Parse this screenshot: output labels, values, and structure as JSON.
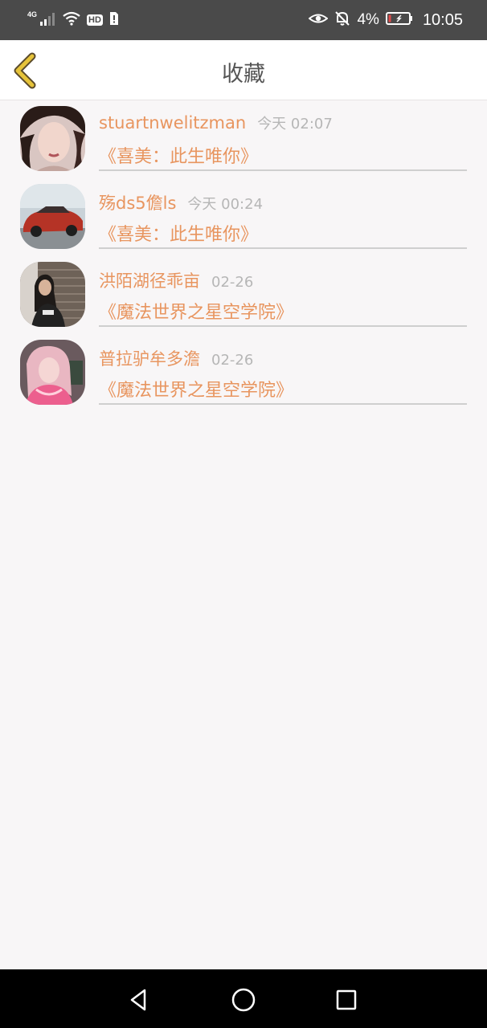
{
  "status_bar": {
    "network": "4G",
    "battery_percent": "4%",
    "time": "10:05",
    "hd_label": "HD",
    "icons": [
      "signal-icon",
      "wifi-icon",
      "hd-icon",
      "sim-icon",
      "eye-icon",
      "mute-bell-icon",
      "battery-icon"
    ]
  },
  "header": {
    "title": "收藏",
    "back_icon": "chevron-left-icon"
  },
  "favorites": [
    {
      "name": "stuartnwelitzman",
      "time": "今天 02:07",
      "book": "《喜美：此生唯你》"
    },
    {
      "name": "殇ds5儋ls",
      "time": "今天 00:24",
      "book": "《喜美：此生唯你》"
    },
    {
      "name": "洪陌湖径乖亩",
      "time": "02-26",
      "book": "《魔法世界之星空学院》"
    },
    {
      "name": "普拉驴牟多澹",
      "time": "02-26",
      "book": "《魔法世界之星空学院》"
    }
  ],
  "colors": {
    "accent": "#e8955f",
    "back_icon": "#e6c33a",
    "time_text": "#b6b6b6",
    "background": "#f8f6f7"
  },
  "nav_bar": {
    "buttons": [
      "back-triangle-icon",
      "home-circle-icon",
      "recents-square-icon"
    ]
  }
}
